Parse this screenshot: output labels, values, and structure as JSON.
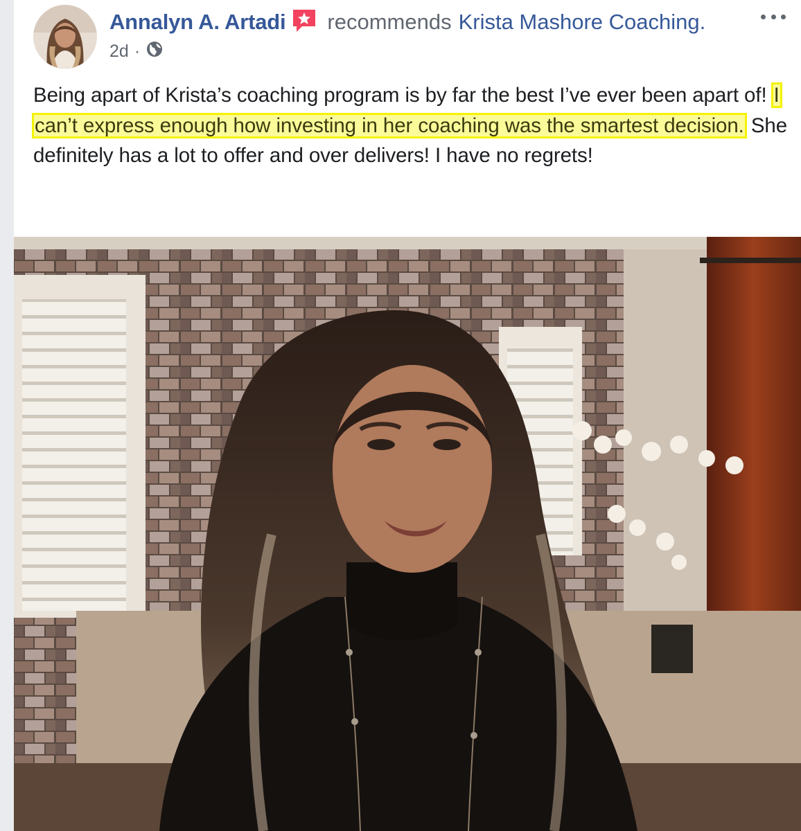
{
  "post": {
    "author": "Annalyn A. Artadi",
    "action": "recommends",
    "page": "Krista Mashore Coaching",
    "page_suffix": ".",
    "time": "2d",
    "separator": "·",
    "icons": {
      "avatar": "profile-photo",
      "recommendation": "recommendation-star-icon",
      "audience": "globe-icon",
      "menu": "more-options-icon"
    },
    "text": {
      "part1": "Being apart of Krista’s coaching program is by far the best I’ve ever been apart of! ",
      "highlight": "I can’t express enough how investing in her coaching was the smartest decision.",
      "part2": " She definitely has a lot to offer and over delivers! I have no regrets!"
    },
    "colors": {
      "link": "#365899",
      "meta": "#606770",
      "recommendation_icon": "#f3425f",
      "highlight_fill": "#fbfb99",
      "highlight_border": "#f5f200"
    }
  }
}
